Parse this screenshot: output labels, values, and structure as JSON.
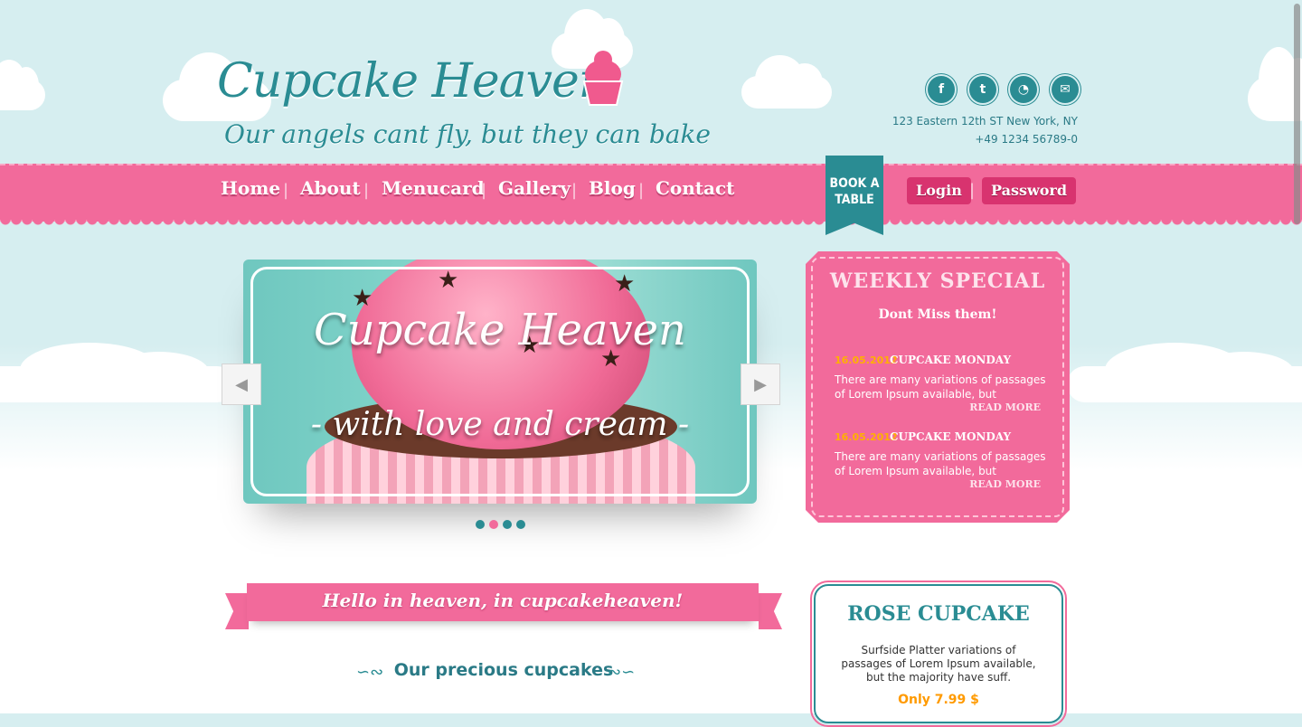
{
  "header": {
    "logo_title": "Cupcake Heaven",
    "tagline": "Our angels cant fly, but they can bake",
    "social": [
      "facebook-icon",
      "twitter-icon",
      "rss-icon",
      "email-icon"
    ],
    "social_glyphs": [
      "f",
      "t",
      "◔",
      "✉"
    ],
    "address": "123 Eastern 12th ST New York, NY",
    "phone": "+49 1234 56789-0"
  },
  "nav": {
    "items": [
      "Home",
      "About",
      "Menucard",
      "Gallery",
      "Blog",
      "Contact"
    ],
    "separator": "|",
    "book_table": "BOOK A TABLE",
    "login": "Login",
    "password": "Password"
  },
  "slider": {
    "title": "Cupcake Heaven",
    "subtitle": "- with love and cream -",
    "prev": "◀",
    "next": "▶",
    "dots": 4,
    "active_dot": 1
  },
  "weekly": {
    "title": "WEEKLY SPECIAL",
    "subtitle": "Dont Miss them!",
    "entries": [
      {
        "date": "16.05.2012",
        "title": "CUPCAKE MONDAY",
        "text": "There are many variations of passages of Lorem Ipsum available, but",
        "more": "READ MORE"
      },
      {
        "date": "16.05.2012",
        "title": "CUPCAKE MONDAY",
        "text": "There are many variations of passages of Lorem Ipsum available, but",
        "more": "READ MORE"
      }
    ]
  },
  "welcome": {
    "ribbon": "Hello in heaven, in cupcakeheaven!",
    "section_title": "Our precious cupcakes"
  },
  "rose": {
    "title": "ROSE CUPCAKE",
    "text": "Surfside Platter variations of passages of Lorem Ipsum available, but the majority have suff.",
    "price": "Only 7.99 $"
  },
  "colors": {
    "teal": "#2a8c93",
    "pink": "#f26a9b",
    "dark_pink": "#d8336f",
    "orange": "#ff9a00"
  }
}
